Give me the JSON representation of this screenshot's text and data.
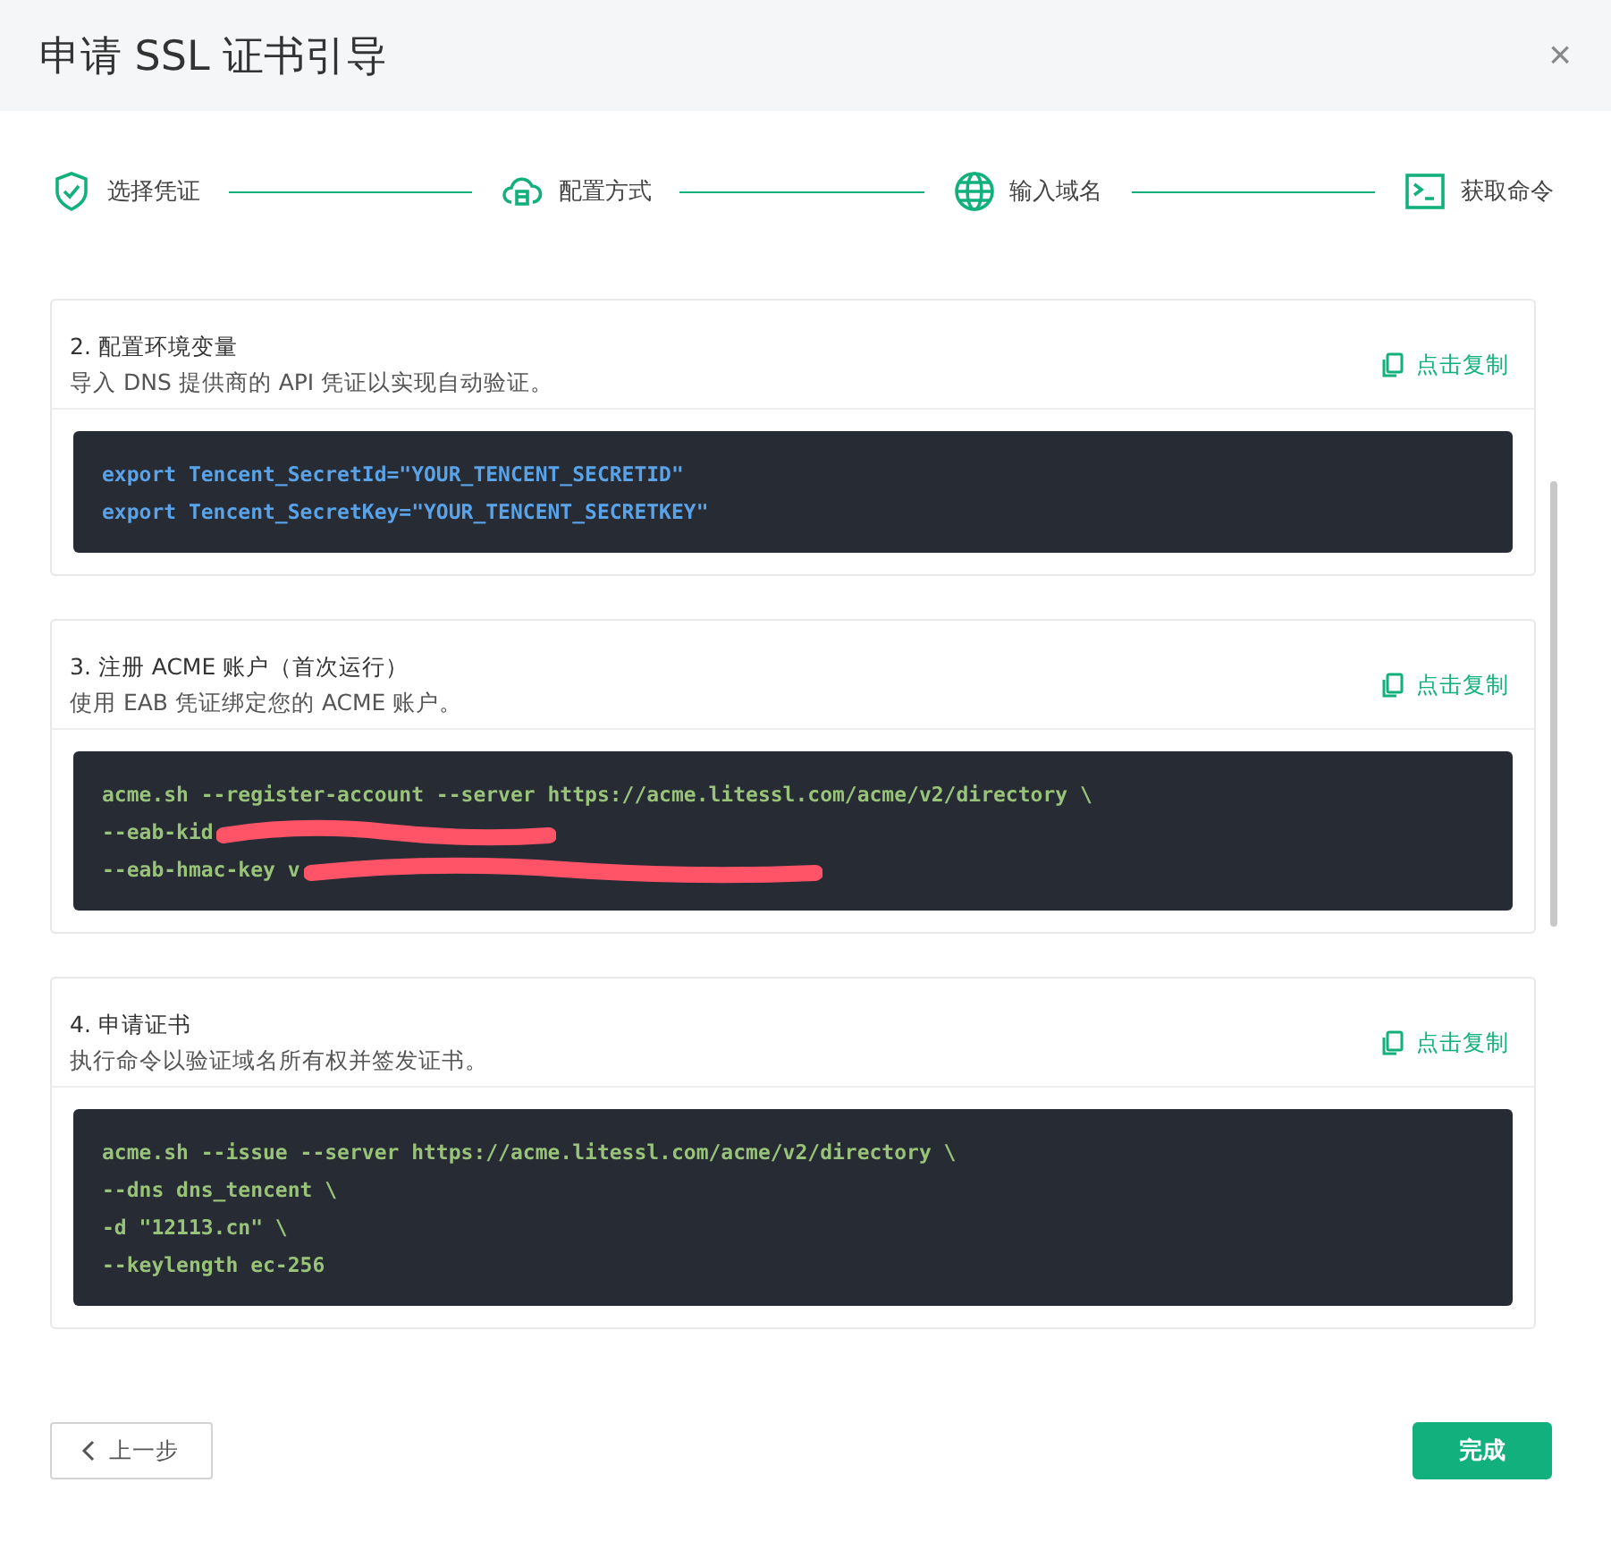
{
  "window": {
    "title": "申请 SSL 证书引导",
    "close": "×"
  },
  "steps": [
    {
      "label": "选择凭证"
    },
    {
      "label": "配置方式"
    },
    {
      "label": "输入域名"
    },
    {
      "label": "获取命令"
    }
  ],
  "cards": [
    {
      "title": "2. 配置环境变量",
      "description": "导入 DNS 提供商的 API 凭证以实现自动验证。",
      "copy": "点击复制",
      "kind": "env",
      "lines": [
        {
          "text": "export Tencent_SecretId=\"YOUR_TENCENT_SECRETID\"",
          "redacted": false
        },
        {
          "text": "export Tencent_SecretKey=\"YOUR_TENCENT_SECRETKEY\"",
          "redacted": false
        }
      ]
    },
    {
      "title": "3. 注册 ACME 账户（首次运行）",
      "description": "使用 EAB 凭证绑定您的 ACME 账户。",
      "copy": "点击复制",
      "kind": "command",
      "lines": [
        {
          "text": "acme.sh --register-account --server https://acme.litessl.com/acme/v2/directory \\",
          "redacted": false
        },
        {
          "text": "--eab-kid",
          "redacted": true
        },
        {
          "text": "--eab-hmac-key v",
          "redacted": true
        }
      ]
    },
    {
      "title": "4. 申请证书",
      "description": "执行命令以验证域名所有权并签发证书。",
      "copy": "点击复制",
      "kind": "command",
      "lines": [
        {
          "text": "acme.sh --issue --server https://acme.litessl.com/acme/v2/directory \\",
          "redacted": false
        },
        {
          "text": "--dns dns_tencent \\",
          "redacted": false
        },
        {
          "text": "-d \"12113.cn\" \\",
          "redacted": false
        },
        {
          "text": "--keylength ec-256",
          "redacted": false
        }
      ]
    }
  ],
  "footer": {
    "back": "上一步",
    "finish": "完成"
  }
}
